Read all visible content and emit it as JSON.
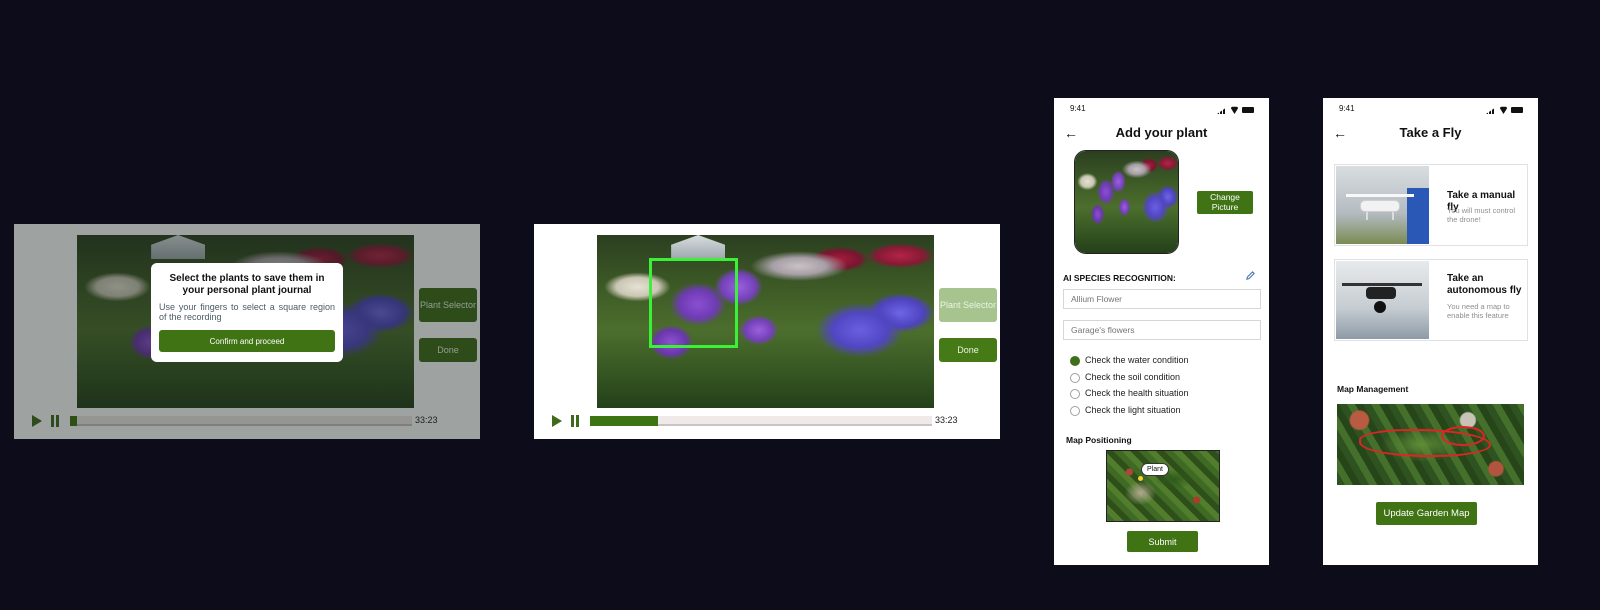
{
  "video_selector_modal": {
    "modal": {
      "title": "Select the plants to save them in your personal plant journal",
      "text": "Use your fingers to select a square region of the recording",
      "confirm_label": "Confirm and proceed"
    },
    "plant_selector_label": "Plant Selector",
    "done_label": "Done",
    "time": "33:23",
    "progress": 0.0
  },
  "video_selector_active": {
    "plant_selector_label": "Plant Selector",
    "done_label": "Done",
    "time": "33:23",
    "progress": 0.2
  },
  "add_plant_screen": {
    "status_time": "9:41",
    "title": "Add your plant",
    "change_picture_label": "Change Picture",
    "ai_label": "AI SPECIES RECOGNITION:",
    "species_placeholder": "Allium Flower",
    "location_placeholder": "Garage's flowers",
    "checks": [
      {
        "label": "Check the water condition",
        "checked": true
      },
      {
        "label": "Check the soil condition",
        "checked": false
      },
      {
        "label": "Check the health situation",
        "checked": false
      },
      {
        "label": "Check the light situation",
        "checked": false
      }
    ],
    "map_label": "Map Positioning",
    "map_tag": "Plant",
    "submit_label": "Submit"
  },
  "take_fly_screen": {
    "status_time": "9:41",
    "title": "Take a Fly",
    "options": [
      {
        "title": "Take a manual fly",
        "desc": "You will must control the drone!"
      },
      {
        "title": "Take an autonomous fly",
        "desc": "You need a map to enable this feature"
      }
    ],
    "map_management_label": "Map Management",
    "update_label": "Update Garden Map"
  },
  "colors": {
    "background": "#0d0c1a",
    "primary_green": "#3f7314",
    "selection_green": "#3cf03a",
    "map_outline": "#e02424"
  }
}
